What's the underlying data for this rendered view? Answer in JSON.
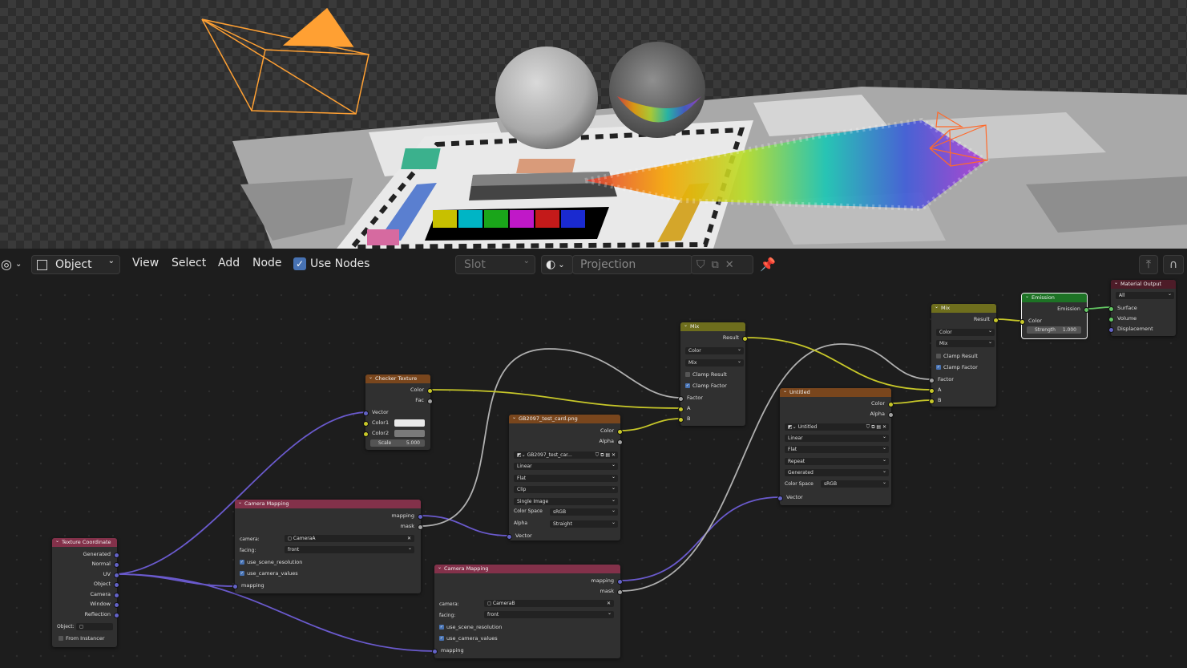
{
  "header": {
    "editor_type_icon": "node-editor-icon",
    "object_mode": "Object",
    "menus": [
      "View",
      "Select",
      "Add",
      "Node"
    ],
    "use_nodes_label": "Use Nodes",
    "use_nodes_checked": true,
    "slot_label": "Slot",
    "material_name": "Projection"
  },
  "nodes": {
    "tex_coord": {
      "title": "Texture Coordinate",
      "outputs": [
        "Generated",
        "Normal",
        "UV",
        "Object",
        "Camera",
        "Window",
        "Reflection"
      ],
      "object_label": "Object:",
      "from_instancer": "From Instancer"
    },
    "camera_mapping_a": {
      "title": "Camera Mapping",
      "out_mapping": "mapping",
      "out_mask": "mask",
      "camera_label": "camera:",
      "camera_value": "CameraA",
      "facing_label": "facing:",
      "facing_value": "front",
      "use_scene_resolution": "use_scene_resolution",
      "use_camera_values": "use_camera_values",
      "in_mapping": "mapping"
    },
    "camera_mapping_b": {
      "title": "Camera Mapping",
      "out_mapping": "mapping",
      "out_mask": "mask",
      "camera_label": "camera:",
      "camera_value": "CameraB",
      "facing_label": "facing:",
      "facing_value": "front",
      "use_scene_resolution": "use_scene_resolution",
      "use_camera_values": "use_camera_values",
      "in_mapping": "mapping"
    },
    "checker": {
      "title": "Checker Texture",
      "out_color": "Color",
      "out_fac": "Fac",
      "in_vector": "Vector",
      "in_color1": "Color1",
      "in_color2": "Color2",
      "scale_label": "Scale",
      "scale_value": "5.000"
    },
    "image_a": {
      "title": "GB2097_test_card.png",
      "out_color": "Color",
      "out_alpha": "Alpha",
      "image_name": "GB2097_test_car...",
      "interpolation": "Linear",
      "projection": "Flat",
      "extension": "Clip",
      "source": "Single Image",
      "color_space_label": "Color Space",
      "color_space": "sRGB",
      "alpha_label": "Alpha",
      "alpha_value": "Straight",
      "in_vector": "Vector"
    },
    "mix1": {
      "title": "Mix",
      "out_result": "Result",
      "data_type": "Color",
      "blend": "Mix",
      "clamp_result": "Clamp Result",
      "clamp_factor": "Clamp Factor",
      "in_factor": "Factor",
      "in_a": "A",
      "in_b": "B"
    },
    "image_b": {
      "title": "Untitled",
      "out_color": "Color",
      "out_alpha": "Alpha",
      "image_name": "Untitled",
      "interpolation": "Linear",
      "projection": "Flat",
      "extension": "Repeat",
      "source": "Generated",
      "color_space_label": "Color Space",
      "color_space": "sRGB",
      "in_vector": "Vector"
    },
    "mix2": {
      "title": "Mix",
      "out_result": "Result",
      "data_type": "Color",
      "blend": "Mix",
      "clamp_result": "Clamp Result",
      "clamp_factor": "Clamp Factor",
      "in_factor": "Factor",
      "in_a": "A",
      "in_b": "B"
    },
    "emission": {
      "title": "Emission",
      "out_emission": "Emission",
      "in_color": "Color",
      "strength_label": "Strength",
      "strength_value": "1.000"
    },
    "material_output": {
      "title": "Material Output",
      "target": "All",
      "in_surface": "Surface",
      "in_volume": "Volume",
      "in_displacement": "Displacement"
    }
  },
  "colors": {
    "header_input": "#83314a",
    "header_texture": "#79461d",
    "header_converter": "#3c3c83",
    "header_color": "#6e6e1d",
    "header_shader": "#1d7325",
    "header_output": "#4d1c28",
    "socket_color": "#c7c729",
    "socket_vector": "#6363c7",
    "socket_float": "#a1a1a1",
    "socket_shader": "#63c763",
    "link_vector": "#6a5acd",
    "link_color": "#c7c729",
    "link_float": "#b0b0b0",
    "accent": "#4772b3",
    "camera_orange": "#ffa033"
  }
}
